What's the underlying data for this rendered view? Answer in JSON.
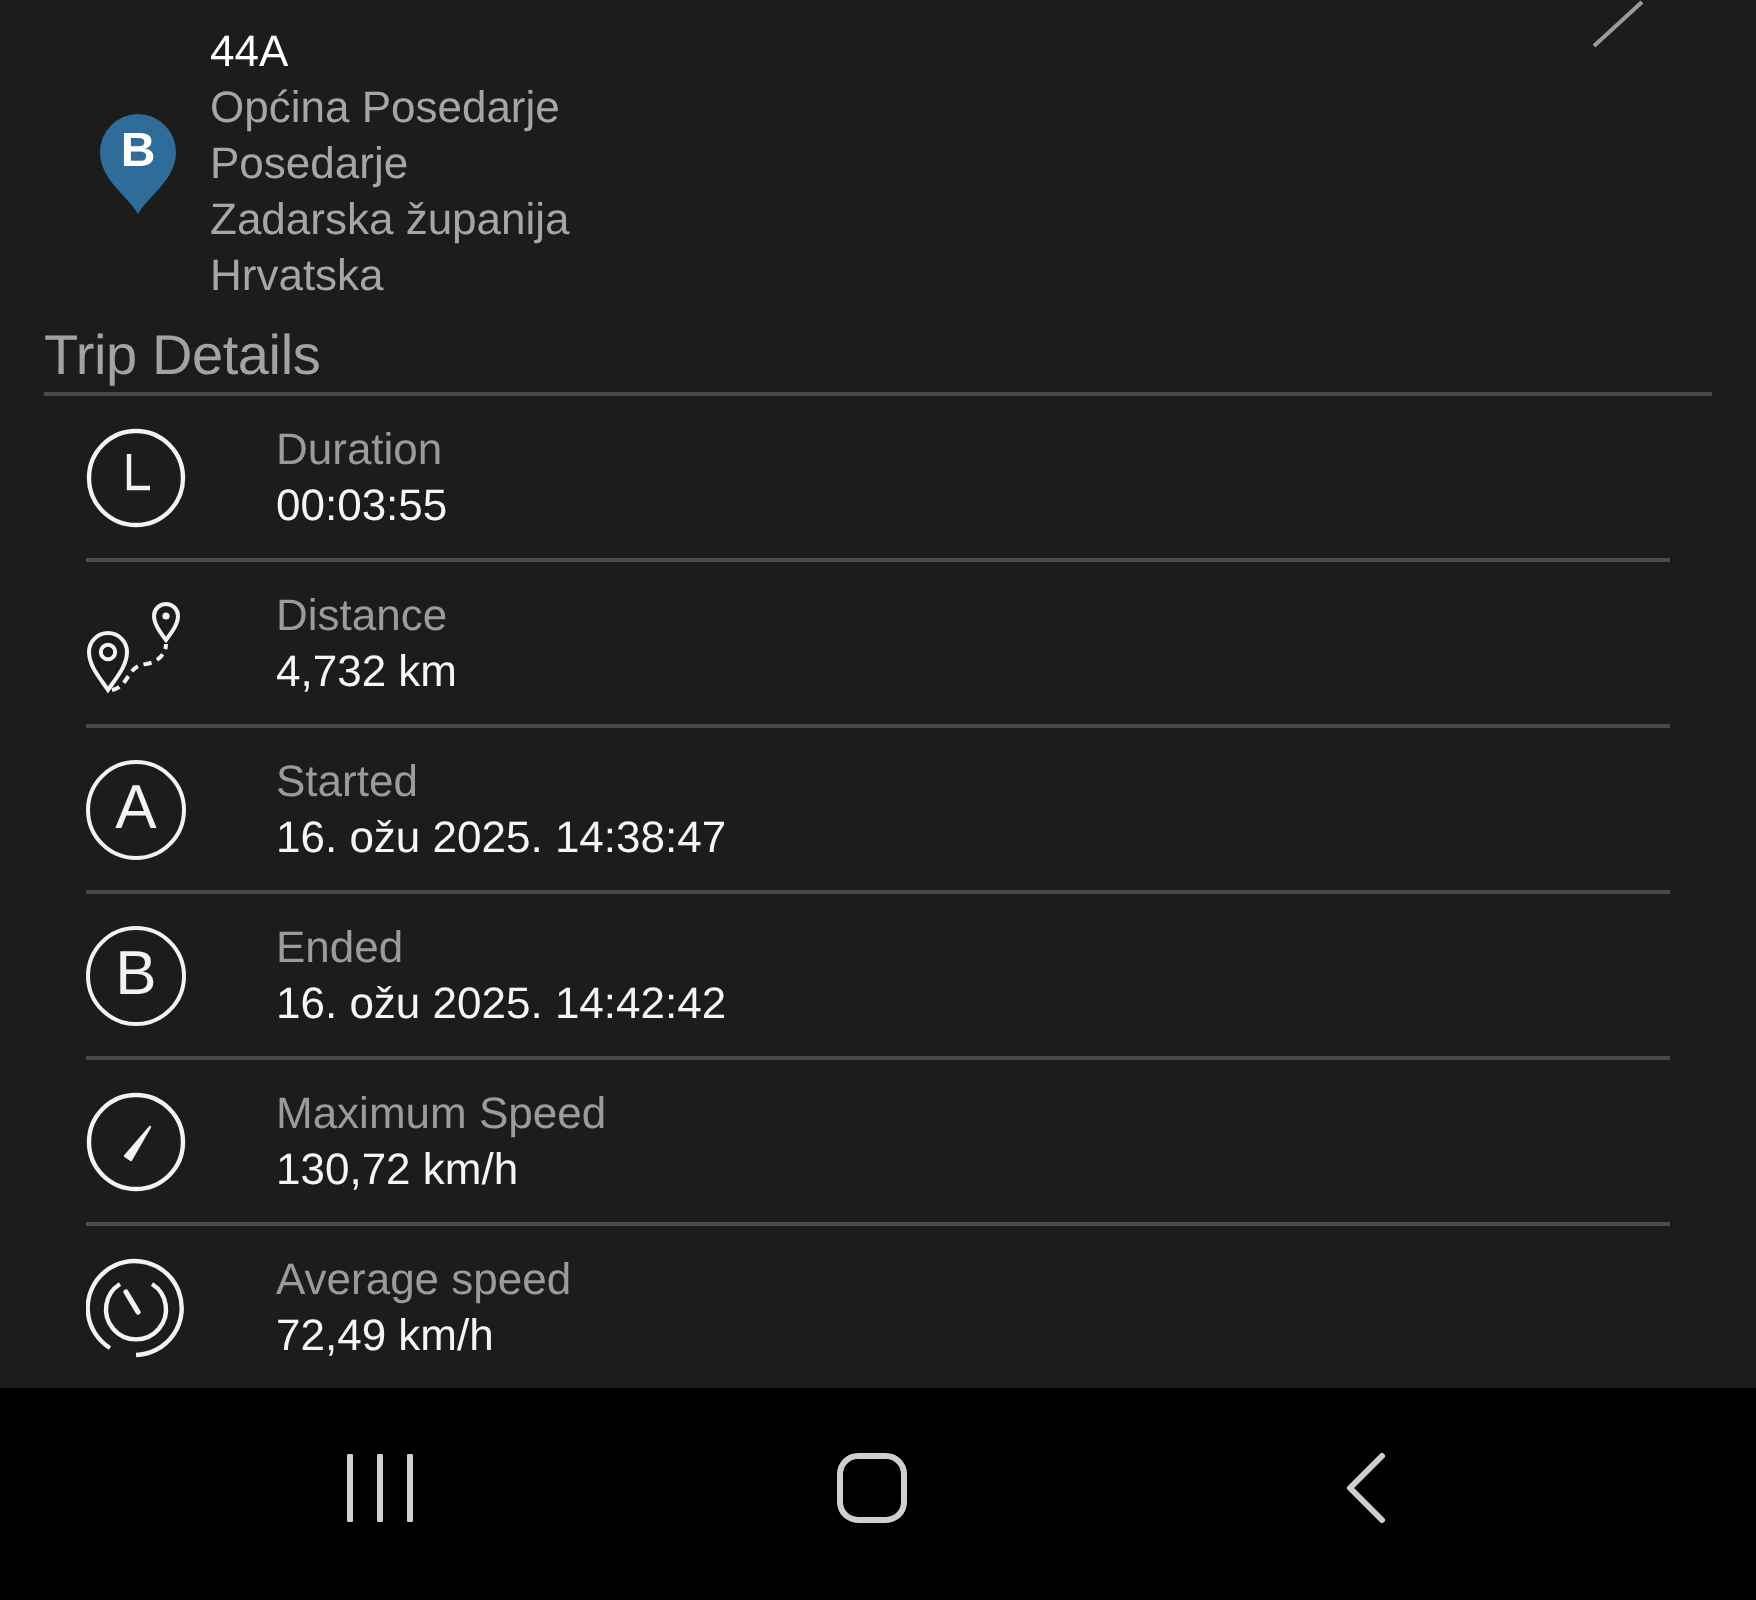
{
  "address": {
    "marker_letter": "B",
    "street_number": "44A",
    "lines": [
      "Općina Posedarje",
      "Posedarje",
      "Zadarska županija",
      "Hrvatska"
    ]
  },
  "section_title": "Trip Details",
  "details": [
    {
      "kind": "clock",
      "label": "Duration",
      "value": "00:03:55"
    },
    {
      "kind": "route",
      "label": "Distance",
      "value": "4,732 km"
    },
    {
      "kind": "letter",
      "letter": "A",
      "label": "Started",
      "value": "16. ožu 2025. 14:38:47"
    },
    {
      "kind": "letter",
      "letter": "B",
      "label": "Ended",
      "value": "16. ožu 2025. 14:42:42"
    },
    {
      "kind": "speedometer",
      "label": "Maximum Speed",
      "value": "130,72 km/h"
    },
    {
      "kind": "gauge",
      "label": "Average speed",
      "value": "72,49 km/h"
    }
  ],
  "nav_bar": {
    "buttons": [
      {
        "kind": "recents"
      },
      {
        "kind": "home"
      },
      {
        "kind": "back"
      }
    ]
  }
}
